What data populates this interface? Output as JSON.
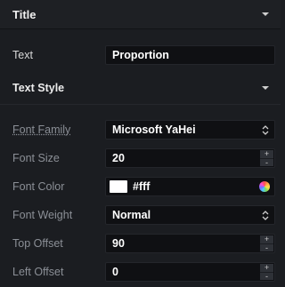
{
  "panel": {
    "title_section": {
      "label": "Title",
      "icon": "chevron-down-icon"
    },
    "text_row": {
      "label": "Text",
      "value": "Proportion"
    },
    "text_style_section": {
      "label": "Text Style",
      "icon": "chevron-down-icon"
    },
    "font_family": {
      "label": "Font Family",
      "value": "Microsoft YaHei",
      "icon": "sort-icon"
    },
    "font_size": {
      "label": "Font Size",
      "value": "20",
      "plus": "+",
      "minus": "-"
    },
    "font_color": {
      "label": "Font Color",
      "value": "#fff",
      "swatch_color": "#ffffff",
      "icon": "color-wheel-icon"
    },
    "font_weight": {
      "label": "Font Weight",
      "value": "Normal",
      "icon": "sort-icon"
    },
    "top_offset": {
      "label": "Top Offset",
      "value": "90",
      "plus": "+",
      "minus": "-"
    },
    "left_offset": {
      "label": "Left Offset",
      "value": "0",
      "plus": "+",
      "minus": "-"
    }
  },
  "colors": {
    "background": "#1b1d21",
    "field_background": "#0f1013",
    "label": "#d9d9d9",
    "dim_label": "#8b8f96"
  }
}
